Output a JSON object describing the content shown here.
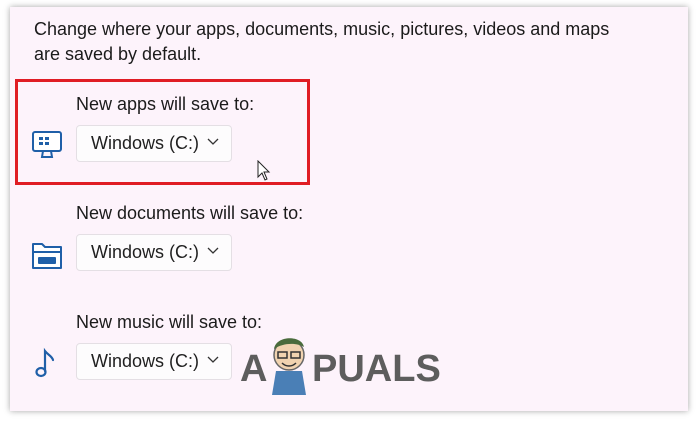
{
  "intro": {
    "line1": "Change where your apps, documents, music, pictures, videos and maps",
    "line2": "are saved by default."
  },
  "rows": [
    {
      "label": "New apps will save to:",
      "value": "Windows (C:)",
      "icon": "computer-icon",
      "highlighted": true
    },
    {
      "label": "New documents will save to:",
      "value": "Windows (C:)",
      "icon": "folder-drive-icon",
      "highlighted": false
    },
    {
      "label": "New music will save to:",
      "value": "Windows (C:)",
      "icon": "music-note-icon",
      "highlighted": false
    }
  ],
  "watermark": {
    "text_left": "A",
    "text_right": "PUALS"
  },
  "colors": {
    "highlight": "#e01c24",
    "icon": "#1f5fa8",
    "background": "#fdf3fb"
  }
}
